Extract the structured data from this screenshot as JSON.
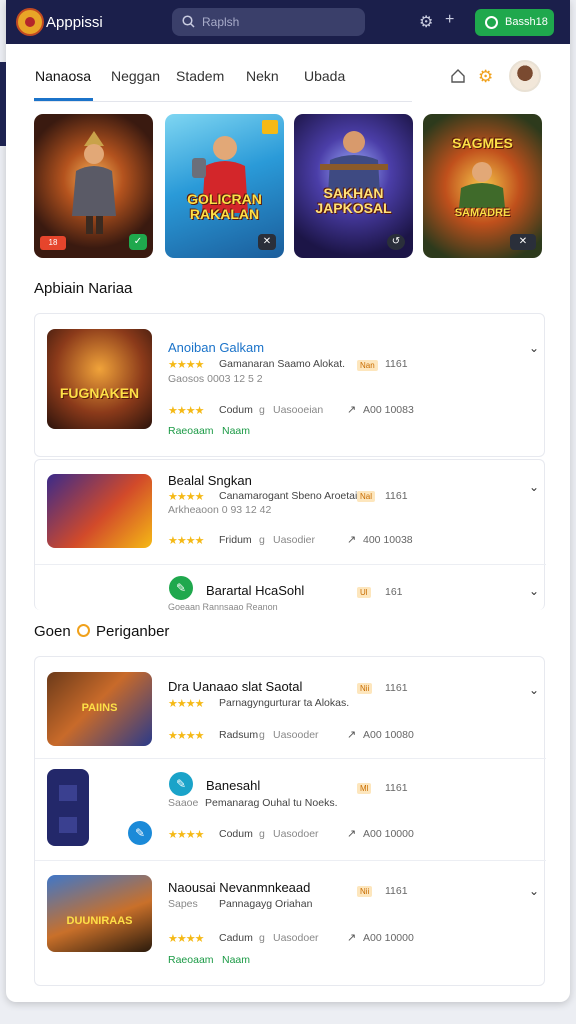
{
  "header": {
    "app_title": "Apppissi",
    "search_placeholder": "Raplsh",
    "cta_label": "Bassh18"
  },
  "tabs": [
    {
      "label": "Nanaosa"
    },
    {
      "label": "Neggan"
    },
    {
      "label": "Stadem"
    },
    {
      "label": "Nekn"
    },
    {
      "label": "Ubada"
    }
  ],
  "featured": [
    {
      "title": "",
      "badge": "18"
    },
    {
      "title": "GOLICRAN RAKALAN",
      "badge": ""
    },
    {
      "title": "SAKHAN JAPKOSAL",
      "badge": ""
    },
    {
      "title": "SAGMES",
      "subtitle": "SAMADRE",
      "badge": ""
    }
  ],
  "section1": {
    "title": "Apbiain Nariaa"
  },
  "section2": {
    "title_a": "Goen",
    "title_b": "Periganber"
  },
  "list1": [
    {
      "title": "Anoiban Galkam",
      "desc": "Gamanaran Saamo Alokat.",
      "tag": "Nan",
      "num": "1161",
      "sub": "Gaosos 0003 12 5 2",
      "rating_label": "Codum",
      "cat": "Uasooeian",
      "share_count": "A00 10083",
      "link_a": "Raeoaam",
      "link_b": "Naam"
    },
    {
      "title": "Bealal Sngkan",
      "desc": "Canamarogant Sbeno Aroetai.",
      "tag": "Nal",
      "num": "1161",
      "sub": "Arkheaoon 0 93 12 42",
      "rating_label": "Fridum",
      "cat": "Uasodier",
      "share_count": "400 10038"
    },
    {
      "title": "Barartal HcaSohl",
      "tag": "Ul",
      "num": "161",
      "sub": "Goeaan Rannsaao Reanon"
    }
  ],
  "list2": [
    {
      "title": "Dra Uanaao slat Saotal",
      "desc": "Parnagyngurturar ta Alokas.",
      "tag": "Nii",
      "num": "1161",
      "rating_label": "Radsum",
      "cat": "Uasooder",
      "share_count": "A00 10080"
    },
    {
      "title": "Banesahl",
      "desc": "Pemanarag Ouhal tu Noeks.",
      "tag": "Ml",
      "num": "1161",
      "sub": "Saaoe",
      "rating_label": "Codum",
      "cat": "Uasodoer",
      "share_count": "A00 10000"
    },
    {
      "title": "Naousai Nevanmnkeaad",
      "desc": "Pannagayg Oriahan",
      "tag": "Nii",
      "num": "1161",
      "sub": "Sapes",
      "rating_label": "Cadum",
      "cat": "Uasodoer",
      "share_count": "A00 10000",
      "link_a": "Raeoaam",
      "link_b": "Naam"
    }
  ],
  "colors": {
    "topbar": "#1b1f4b",
    "accent": "#1b73c9",
    "green": "#1fa84d",
    "star": "#f5b915"
  }
}
